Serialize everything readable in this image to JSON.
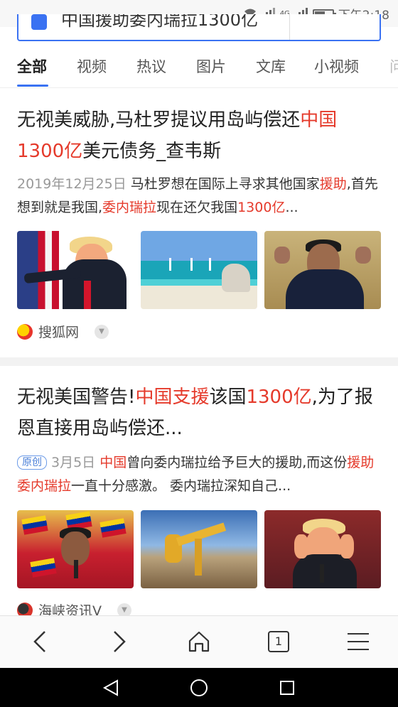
{
  "status_bar": {
    "network": "4G",
    "time": "下午2:18",
    "battery_level": 0.55
  },
  "search": {
    "query": "中国援助委内瑞拉1300亿"
  },
  "tabs": [
    "全部",
    "视频",
    "热议",
    "图片",
    "文库",
    "小视频",
    "问"
  ],
  "results": [
    {
      "title_parts": [
        {
          "text": "无视美威胁,马杜罗提议用岛屿偿还",
          "hl": false
        },
        {
          "text": "中国",
          "hl": true
        },
        {
          "text": "1300亿",
          "hl": true
        },
        {
          "text": "美元债务_查韦斯",
          "hl": false
        }
      ],
      "date": "2019年12月25日",
      "snippet_parts": [
        {
          "text": "马杜罗想在国际上寻求其他国家",
          "hl": false
        },
        {
          "text": "援助",
          "hl": true
        },
        {
          "text": ",首先想到就是我国,",
          "hl": false
        },
        {
          "text": "委内瑞拉",
          "hl": true
        },
        {
          "text": "现在还欠我国",
          "hl": false
        },
        {
          "text": "1300亿",
          "hl": true
        },
        {
          "text": "...",
          "hl": false
        }
      ],
      "source": "搜狐网"
    },
    {
      "title_parts": [
        {
          "text": "无视美国警告!",
          "hl": false
        },
        {
          "text": "中国支援",
          "hl": true
        },
        {
          "text": "该国",
          "hl": false
        },
        {
          "text": "1300亿",
          "hl": true
        },
        {
          "text": ",为了报恩直接用岛屿偿还...",
          "hl": false
        }
      ],
      "badge": "原创",
      "date": "3月5日",
      "snippet_parts": [
        {
          "text": "中国",
          "hl": true
        },
        {
          "text": "曾向委内瑞拉给予巨大的援助,而这份",
          "hl": false
        },
        {
          "text": "援助委内瑞拉",
          "hl": true
        },
        {
          "text": "一直十分感激。 委内瑞拉深知自己...",
          "hl": false
        }
      ],
      "source": "海峡资讯V"
    }
  ],
  "browser_bar": {
    "tab_count": "1"
  },
  "colors": {
    "accent": "#3a72f2",
    "highlight": "#e53a2b"
  }
}
